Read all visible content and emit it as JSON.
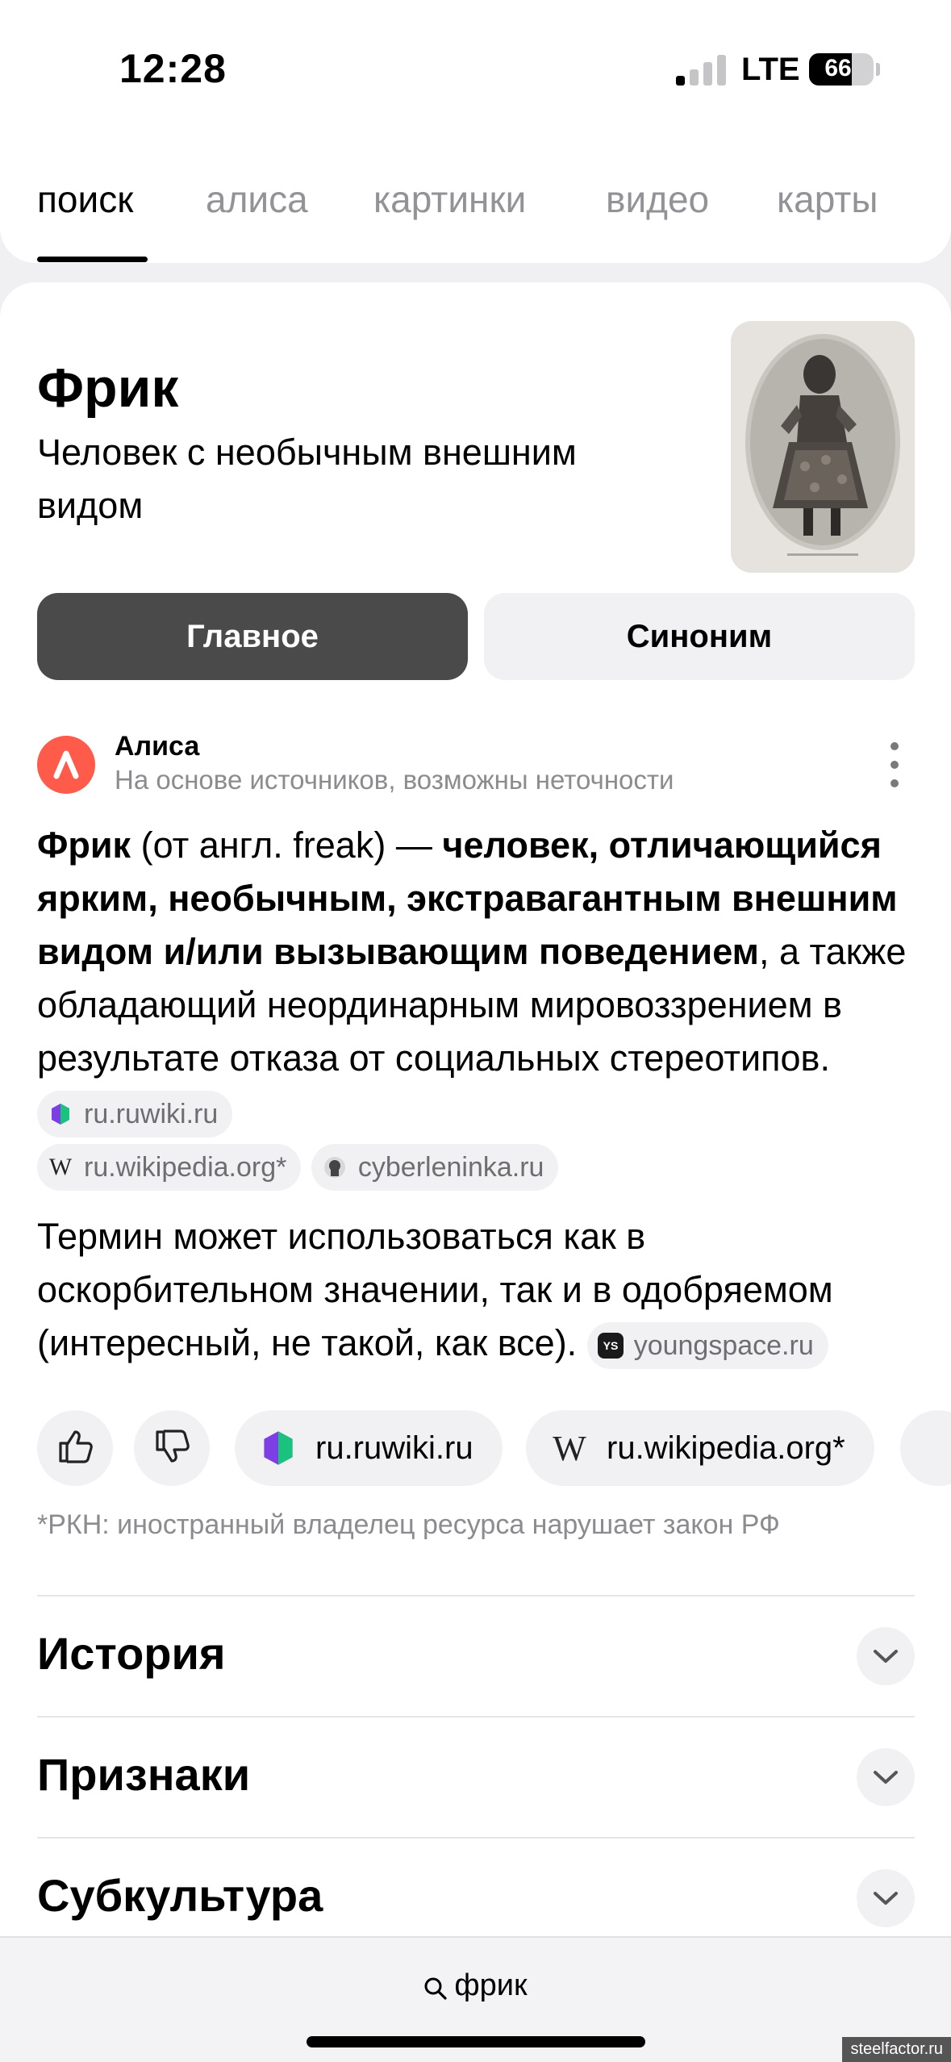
{
  "status_bar": {
    "time": "12:28",
    "network": "LTE",
    "battery_percent": "66",
    "signal_bars_active": 1
  },
  "tabs": [
    {
      "label": "поиск",
      "active": true
    },
    {
      "label": "алиса",
      "active": false
    },
    {
      "label": "картинки",
      "active": false
    },
    {
      "label": "видео",
      "active": false
    },
    {
      "label": "карты",
      "active": false
    }
  ],
  "entity": {
    "title": "Фрик",
    "subtitle": "Человек с необычным внешним видом"
  },
  "segments": {
    "main": "Главное",
    "synonym": "Синоним"
  },
  "alice": {
    "name": "Алиса",
    "note": "На основе источников, возможны неточности"
  },
  "answer": {
    "p1_term": "Фрик",
    "p1_plain1": " (от англ. freak) — ",
    "p1_bold": "человек, отличающийся ярким, необычным, экстравагантным внешним видом и/или вызывающим поведением",
    "p1_plain2": ", а также обладающий неординарным мировоззрением в результате отказа от социальных стереотипов. ",
    "p1_sources": [
      "ru.ruwiki.ru",
      "ru.wikipedia.org*",
      "cyberleninka.ru"
    ],
    "p2_text": "Термин может использоваться как в оскорбительном значении, так и в одобряемом (интересный, не такой, как все). ",
    "p2_source": "youngspace.ru"
  },
  "source_buttons": [
    "ru.ruwiki.ru",
    "ru.wikipedia.org*"
  ],
  "rkn_note": "*РКН: иностранный владелец ресурса нарушает закон РФ",
  "sections": [
    "История",
    "Признаки",
    "Субкультура"
  ],
  "search_bar": {
    "query": "фрик"
  },
  "watermark": "steelfactor.ru",
  "colors": {
    "alice_brand": "#ff5b4a",
    "active_segment": "#4a4a4a",
    "chip_bg": "#f1f1f3",
    "muted_text": "#8c8c90"
  }
}
